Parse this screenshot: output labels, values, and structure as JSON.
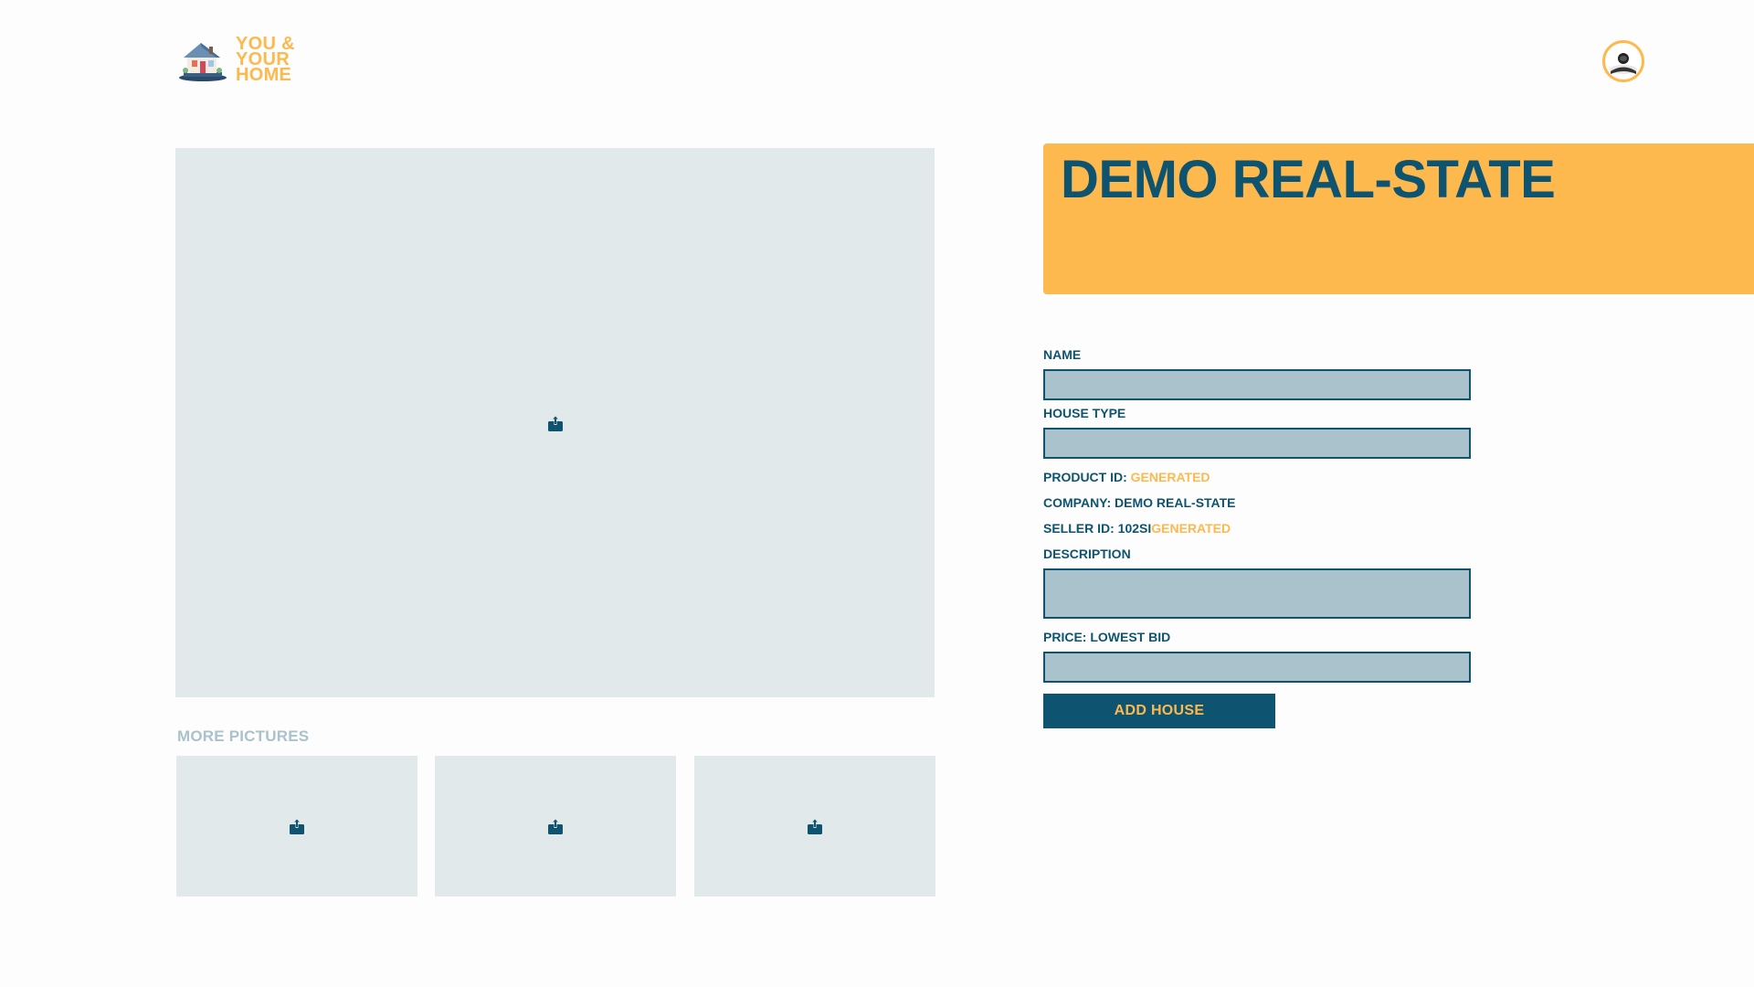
{
  "header": {
    "logo_lines": [
      "YOU &",
      "YOUR",
      "HOME"
    ],
    "avatar_icon": "user-avatar-icon"
  },
  "gallery": {
    "upload_icon": "upload-icon",
    "more_label": "MORE PICTURES",
    "thumbnail_count": 3
  },
  "banner": {
    "title": "DEMO REAL-STATE"
  },
  "form": {
    "name_label": "NAME",
    "name_value": "",
    "house_type_label": "HOUSE TYPE",
    "house_type_value": "",
    "product_id_label": "PRODUCT ID:",
    "product_id_value": "GENERATED",
    "company_label": "COMPANY: DEMO REAL-STATE",
    "seller_id_label": "SELLER ID: 102SI",
    "seller_id_value": "GENERATED",
    "description_label": "DESCRIPTION",
    "description_value": "",
    "price_label": "PRICE: LOWEST BID",
    "price_value": "",
    "submit_label": "ADD  HOUSE"
  },
  "colors": {
    "navy": "#0e5470",
    "accent": "#fdb94e",
    "input_bg": "#a9c2cc",
    "placeholder_bg": "#e2e9ea"
  }
}
